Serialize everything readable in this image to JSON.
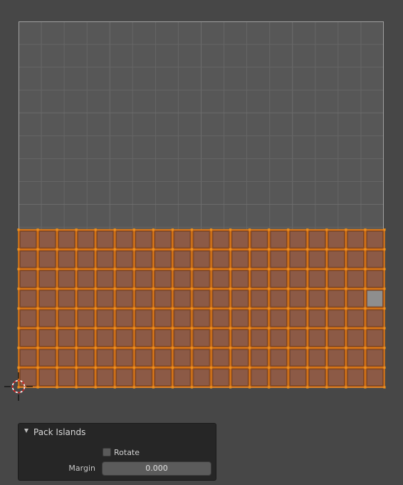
{
  "uv_editor": {
    "grid": {
      "columns": 16,
      "rows": 9,
      "background": "#575757",
      "line_color": "#666666",
      "border_color": "#a0a0a0"
    },
    "mesh": {
      "columns": 19,
      "rows": 8,
      "face_color": "#8c5a46",
      "edge_color": "#e37f17",
      "vertex_color": "#f0901a",
      "highlighted_face_color": "#8e8e8e"
    },
    "cursor_icon": "2d-cursor-icon"
  },
  "operator_panel": {
    "title": "Pack Islands",
    "collapse_icon": "triangle-down-icon",
    "rotate_label": "Rotate",
    "rotate_checked": false,
    "margin_label": "Margin",
    "margin_value": "0.000"
  }
}
